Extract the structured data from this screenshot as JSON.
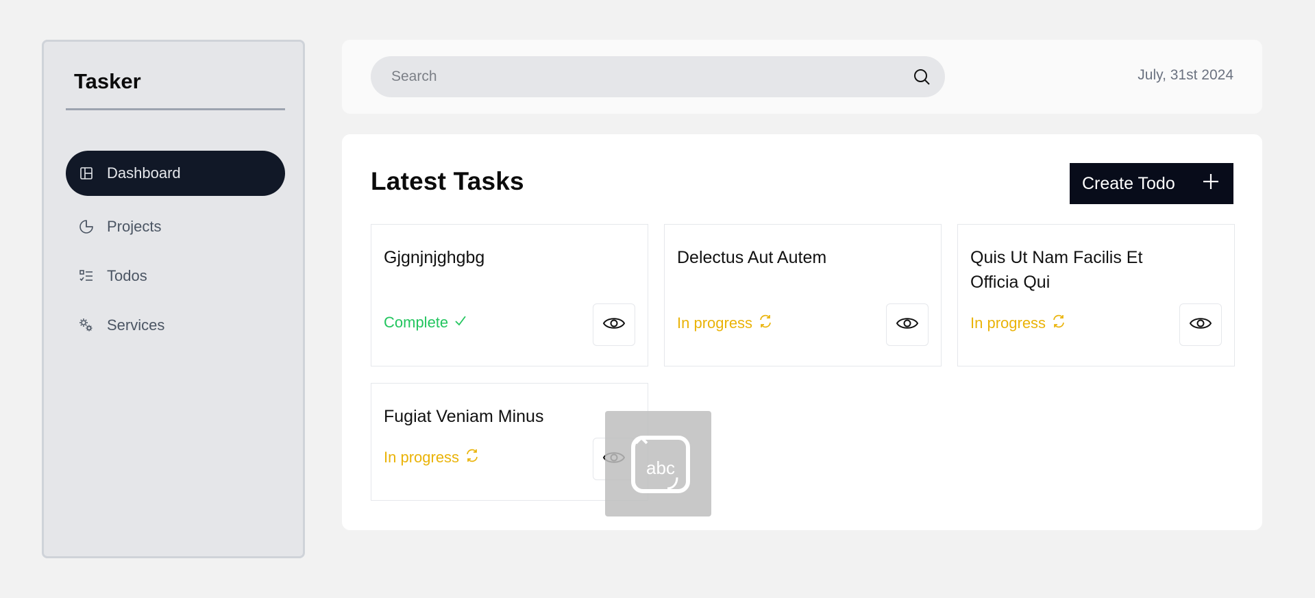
{
  "sidebar": {
    "brand": "Tasker",
    "items": [
      {
        "label": "Dashboard",
        "icon": "layout-icon",
        "active": true
      },
      {
        "label": "Projects",
        "icon": "pie-chart-icon",
        "active": false
      },
      {
        "label": "Todos",
        "icon": "list-check-icon",
        "active": false
      },
      {
        "label": "Services",
        "icon": "gears-icon",
        "active": false
      }
    ]
  },
  "header": {
    "search_placeholder": "Search",
    "date": "July, 31st 2024"
  },
  "main": {
    "title": "Latest Tasks",
    "create_label": "Create Todo",
    "tasks": [
      {
        "title": "Gjgnjnjghgbg",
        "status": "Complete"
      },
      {
        "title": "Delectus Aut Autem",
        "status": "In progress"
      },
      {
        "title": "Quis Ut Nam Facilis Et Officia Qui",
        "status": "In progress"
      },
      {
        "title": "Fugiat Veniam Minus",
        "status": "In progress"
      }
    ]
  },
  "overlay": {
    "label": "abc"
  },
  "colors": {
    "complete": "#22c55e",
    "in_progress": "#eab308",
    "active_nav": "#111827",
    "button": "#080c1a"
  }
}
